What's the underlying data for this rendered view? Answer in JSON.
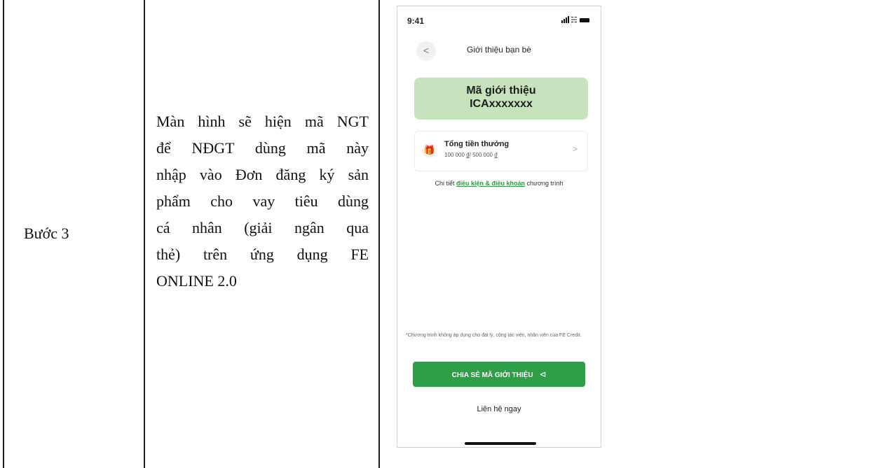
{
  "table": {
    "step_label": "Bước 3",
    "description_lines": [
      "Màn hình sẽ hiện mã NGT",
      "để NĐGT dùng mã này",
      "nhập vào Đơn đăng ký sản",
      "phẩm cho vay tiêu dùng",
      "cá nhân (giải ngân qua",
      "thẻ) trên ứng dụng FE",
      "ONLINE 2.0"
    ]
  },
  "phone": {
    "status_time": "9:41",
    "back_icon": "<",
    "title": "Giới thiệu bạn bè",
    "code_card": {
      "label": "Mã giới thiệu",
      "code": "ICAxxxxxxx",
      "color": "#c7e3bd"
    },
    "reward": {
      "icon": "gift-icon",
      "title": "Tổng tiền thưởng",
      "earned": "100 000",
      "total": "500 000",
      "currency": "đ",
      "chevron": ">"
    },
    "terms": {
      "prefix": "Chi tiết",
      "link": "điều kiện & điều khoản",
      "suffix": "chương trình",
      "link_color": "#2f9a43"
    },
    "note": "*Chương trình không áp dụng cho đại lý, cộng tác viên, nhân viên của FE Credit.",
    "share_button": {
      "label": "CHIA SẺ MÃ GIỚI THIỆU",
      "icon": "share-icon",
      "color": "#2e9e47"
    },
    "contact_label": "Liên hệ ngay"
  }
}
